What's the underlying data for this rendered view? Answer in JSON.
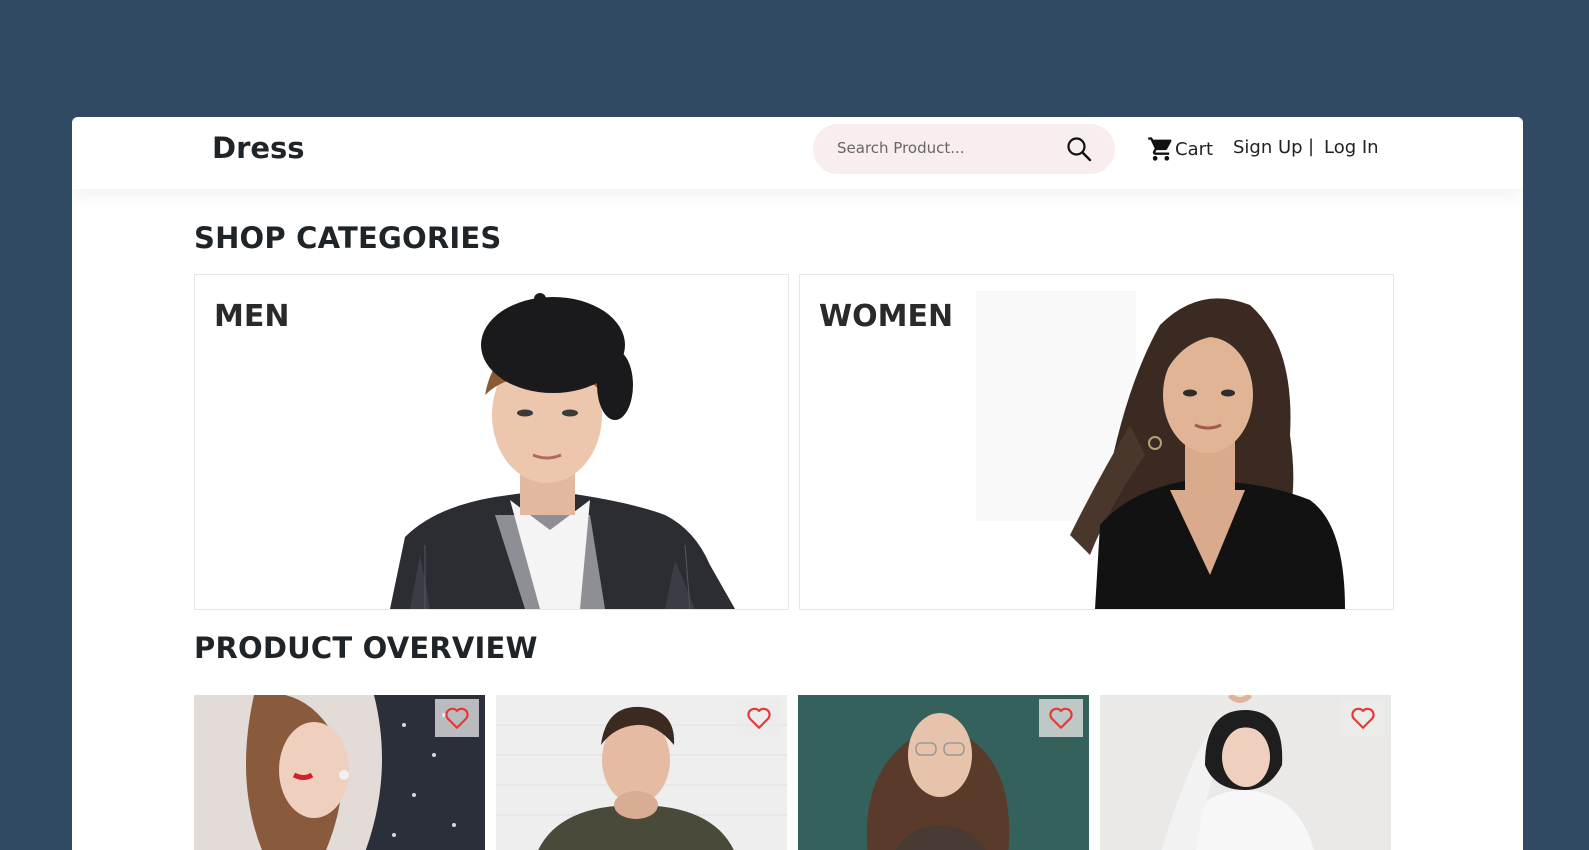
{
  "brand": {
    "name": "Dress"
  },
  "search": {
    "placeholder": "Search Product..."
  },
  "nav": {
    "cart_label": "Cart",
    "signup_label": "Sign Up",
    "separator": "|",
    "login_label": "Log In"
  },
  "categories_section": {
    "title": "SHOP CATEGORIES",
    "items": [
      {
        "label": "MEN",
        "image": "man-in-beret-and-blazer"
      },
      {
        "label": "WOMEN",
        "image": "woman-in-black-v-neck-top"
      }
    ]
  },
  "products_section": {
    "title": "PRODUCT OVERVIEW",
    "items": [
      {
        "image": "woman-with-red-lips-polka-dot-top",
        "favorite_icon": "heart-outline-icon"
      },
      {
        "image": "man-in-olive-jacket-brick-wall",
        "favorite_icon": "heart-outline-icon"
      },
      {
        "image": "woman-with-glasses-teal-wall",
        "favorite_icon": "heart-outline-icon"
      },
      {
        "image": "woman-in-white-blouse",
        "favorite_icon": "heart-outline-icon"
      }
    ]
  },
  "colors": {
    "page_background": "#2f4a62",
    "search_background": "#f8eeee",
    "heart_red": "#e53935",
    "heading_text": "#1f2428"
  }
}
